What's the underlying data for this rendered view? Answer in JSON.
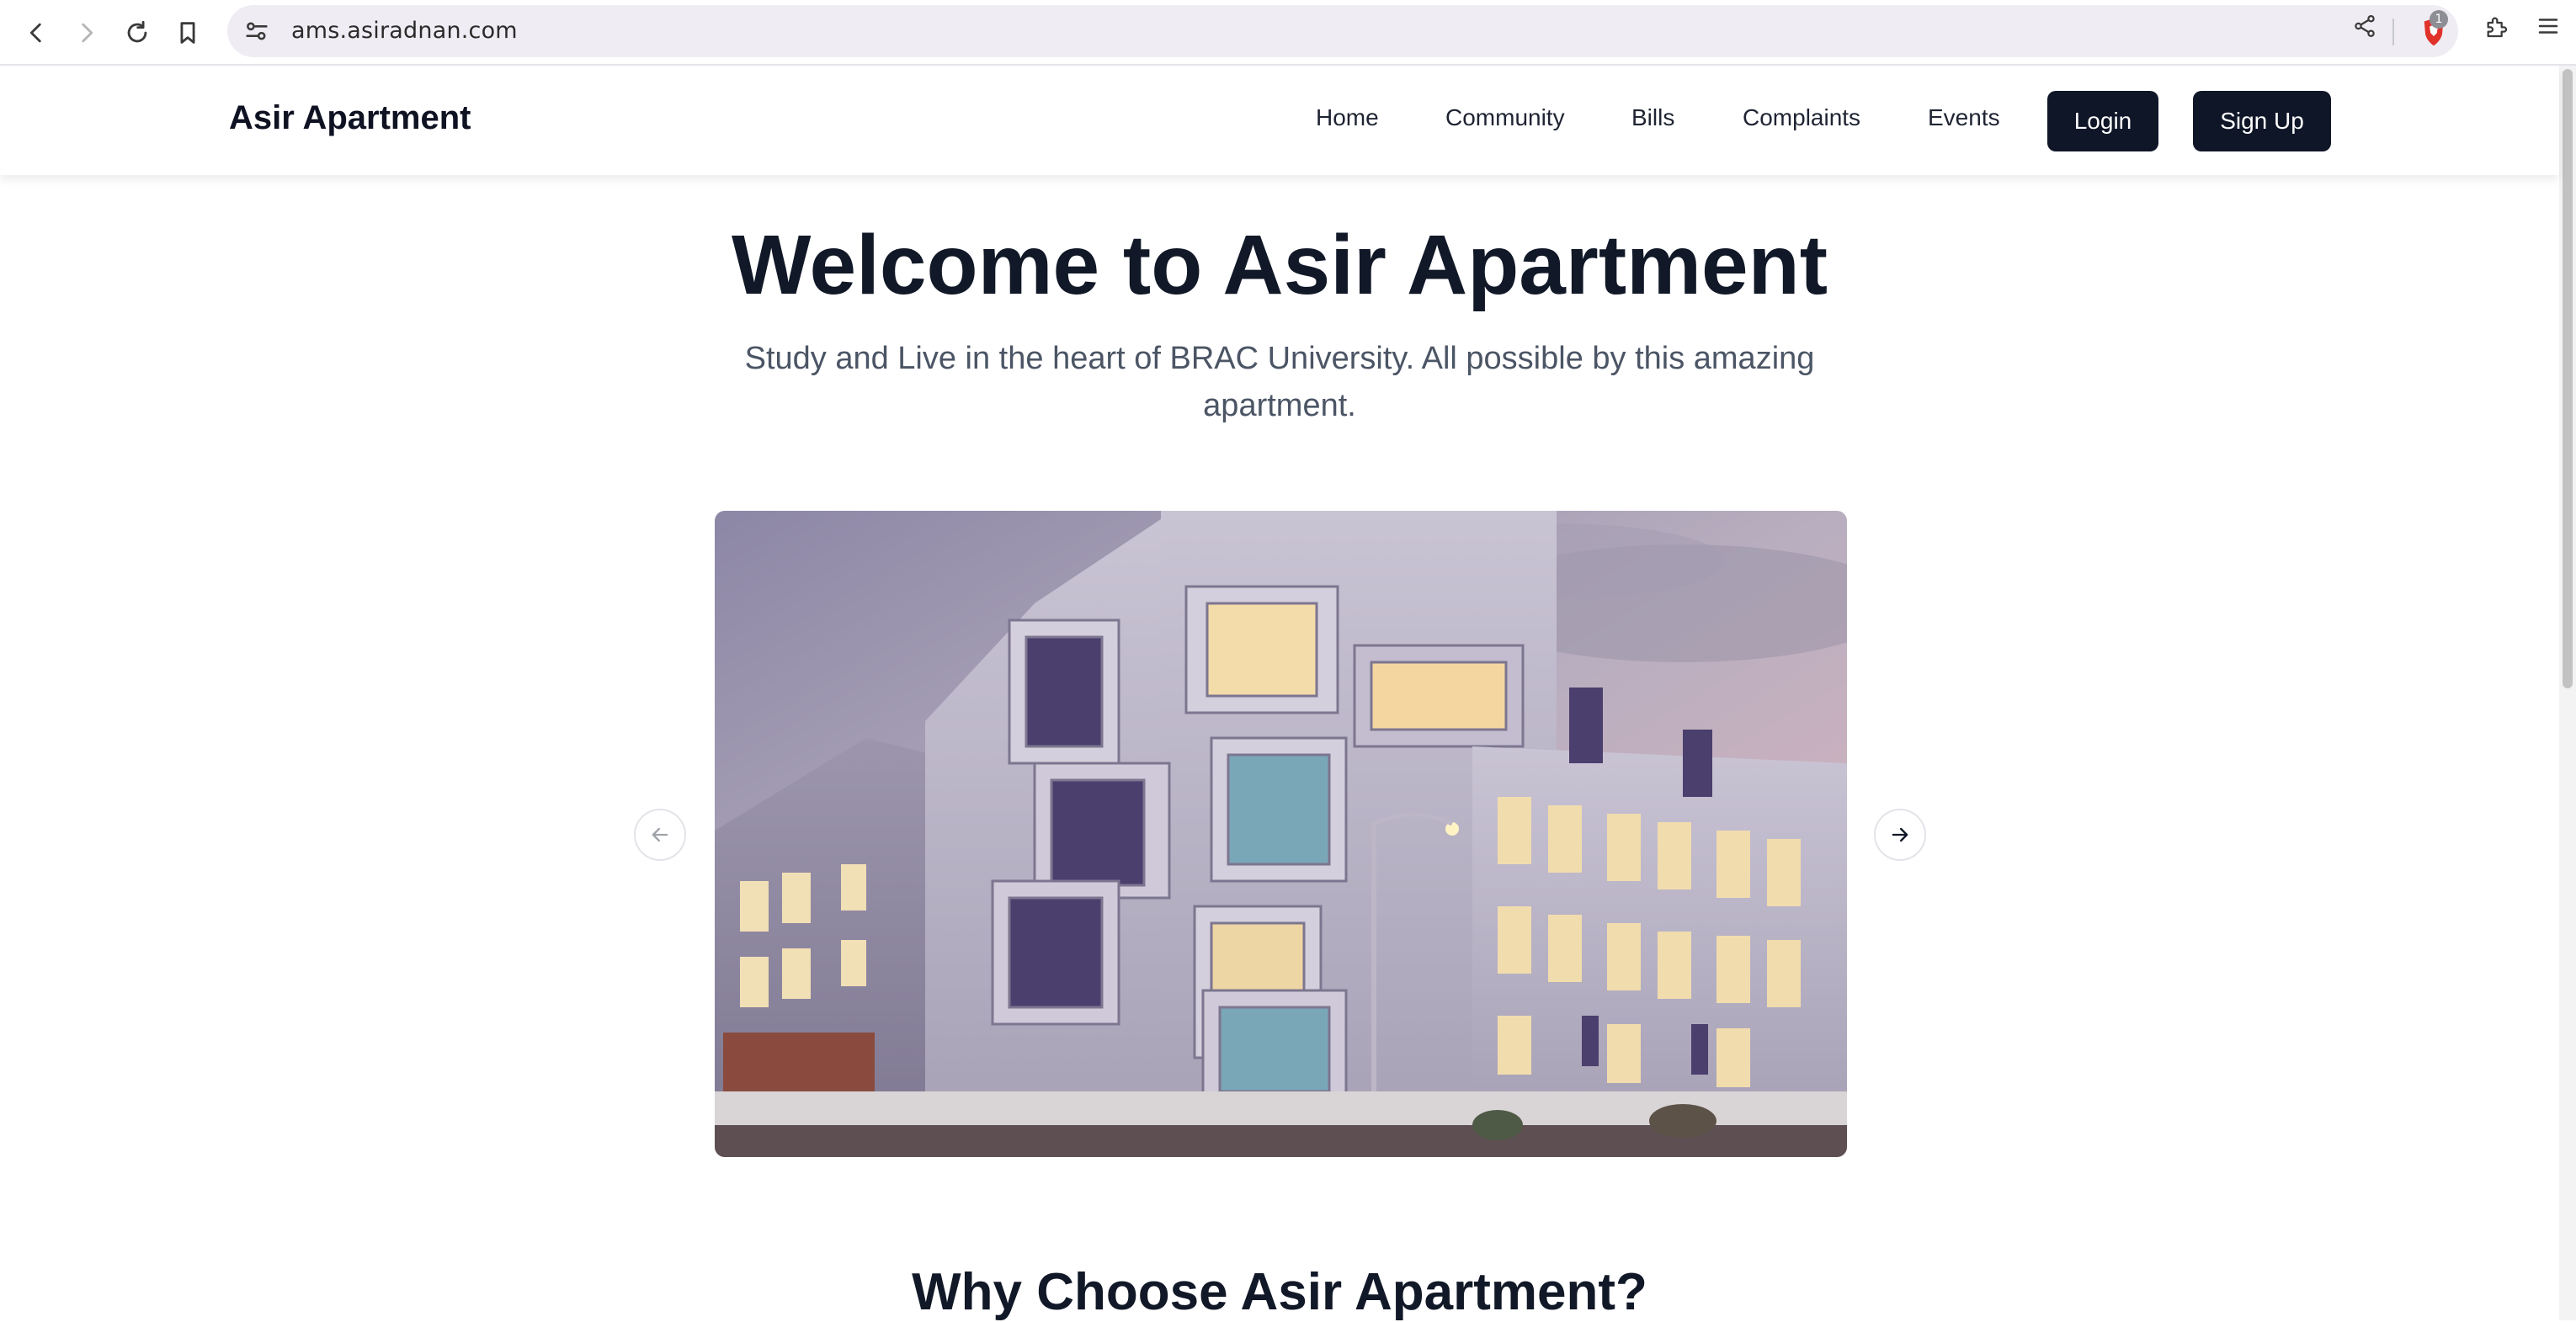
{
  "browser": {
    "url": "ams.asiradnan.com",
    "shields_count": "1",
    "icons": [
      "back-icon",
      "forward-icon",
      "reload-icon",
      "bookmark-icon",
      "site-settings-icon",
      "share-icon",
      "brave-shields-icon",
      "extensions-icon",
      "menu-icon"
    ]
  },
  "header": {
    "brand": "Asir Apartment",
    "nav": {
      "home": "Home",
      "community": "Community",
      "bills": "Bills",
      "complaints": "Complaints",
      "events": "Events"
    },
    "login_label": "Login",
    "signup_label": "Sign Up"
  },
  "hero": {
    "title": "Welcome to Asir Apartment",
    "subtitle": "Study and Live in the heart of BRAC University. All possible by this amazing apartment."
  },
  "carousel": {
    "image_alt": "Asir Apartment",
    "prev_icon": "arrow-left-icon",
    "next_icon": "arrow-right-icon"
  },
  "features": {
    "title": "Why Choose Asir Apartment?"
  },
  "colors": {
    "primary_dark": "#0f1628",
    "heading": "#111827",
    "subtext": "#4b5565"
  }
}
